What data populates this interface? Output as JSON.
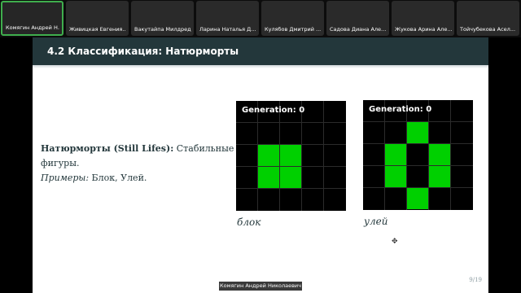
{
  "participants": [
    {
      "name": "Комягин Андрей Н..."
    },
    {
      "name": "Живицкая Евгения..."
    },
    {
      "name": "Вакутайпа Милдред"
    },
    {
      "name": "Ларина Наталья Д..."
    },
    {
      "name": "Кулябов Дмитрий ..."
    },
    {
      "name": "Садова Диана Але..."
    },
    {
      "name": "Жукова Арина Але..."
    },
    {
      "name": "Тойчубекова Асел..."
    }
  ],
  "slide": {
    "title": "4.2 Классификация: Натюрморты",
    "term": "Натюрморты (Still Lifes):",
    "term_rest": " Стабильные",
    "line2": "фигуры.",
    "examples_label": "Примеры:",
    "examples_text": " Блок, Улей.",
    "figures": [
      {
        "generation_label": "Generation: 0",
        "caption": "блок"
      },
      {
        "generation_label": "Generation: 0",
        "caption": "улей"
      }
    ],
    "page": "9/19"
  },
  "active_speaker": "Комягин Андрей Николаевич",
  "colors": {
    "title_bar": "#23373b",
    "live_cell": "#00d000",
    "active_border": "#3fae4d"
  }
}
